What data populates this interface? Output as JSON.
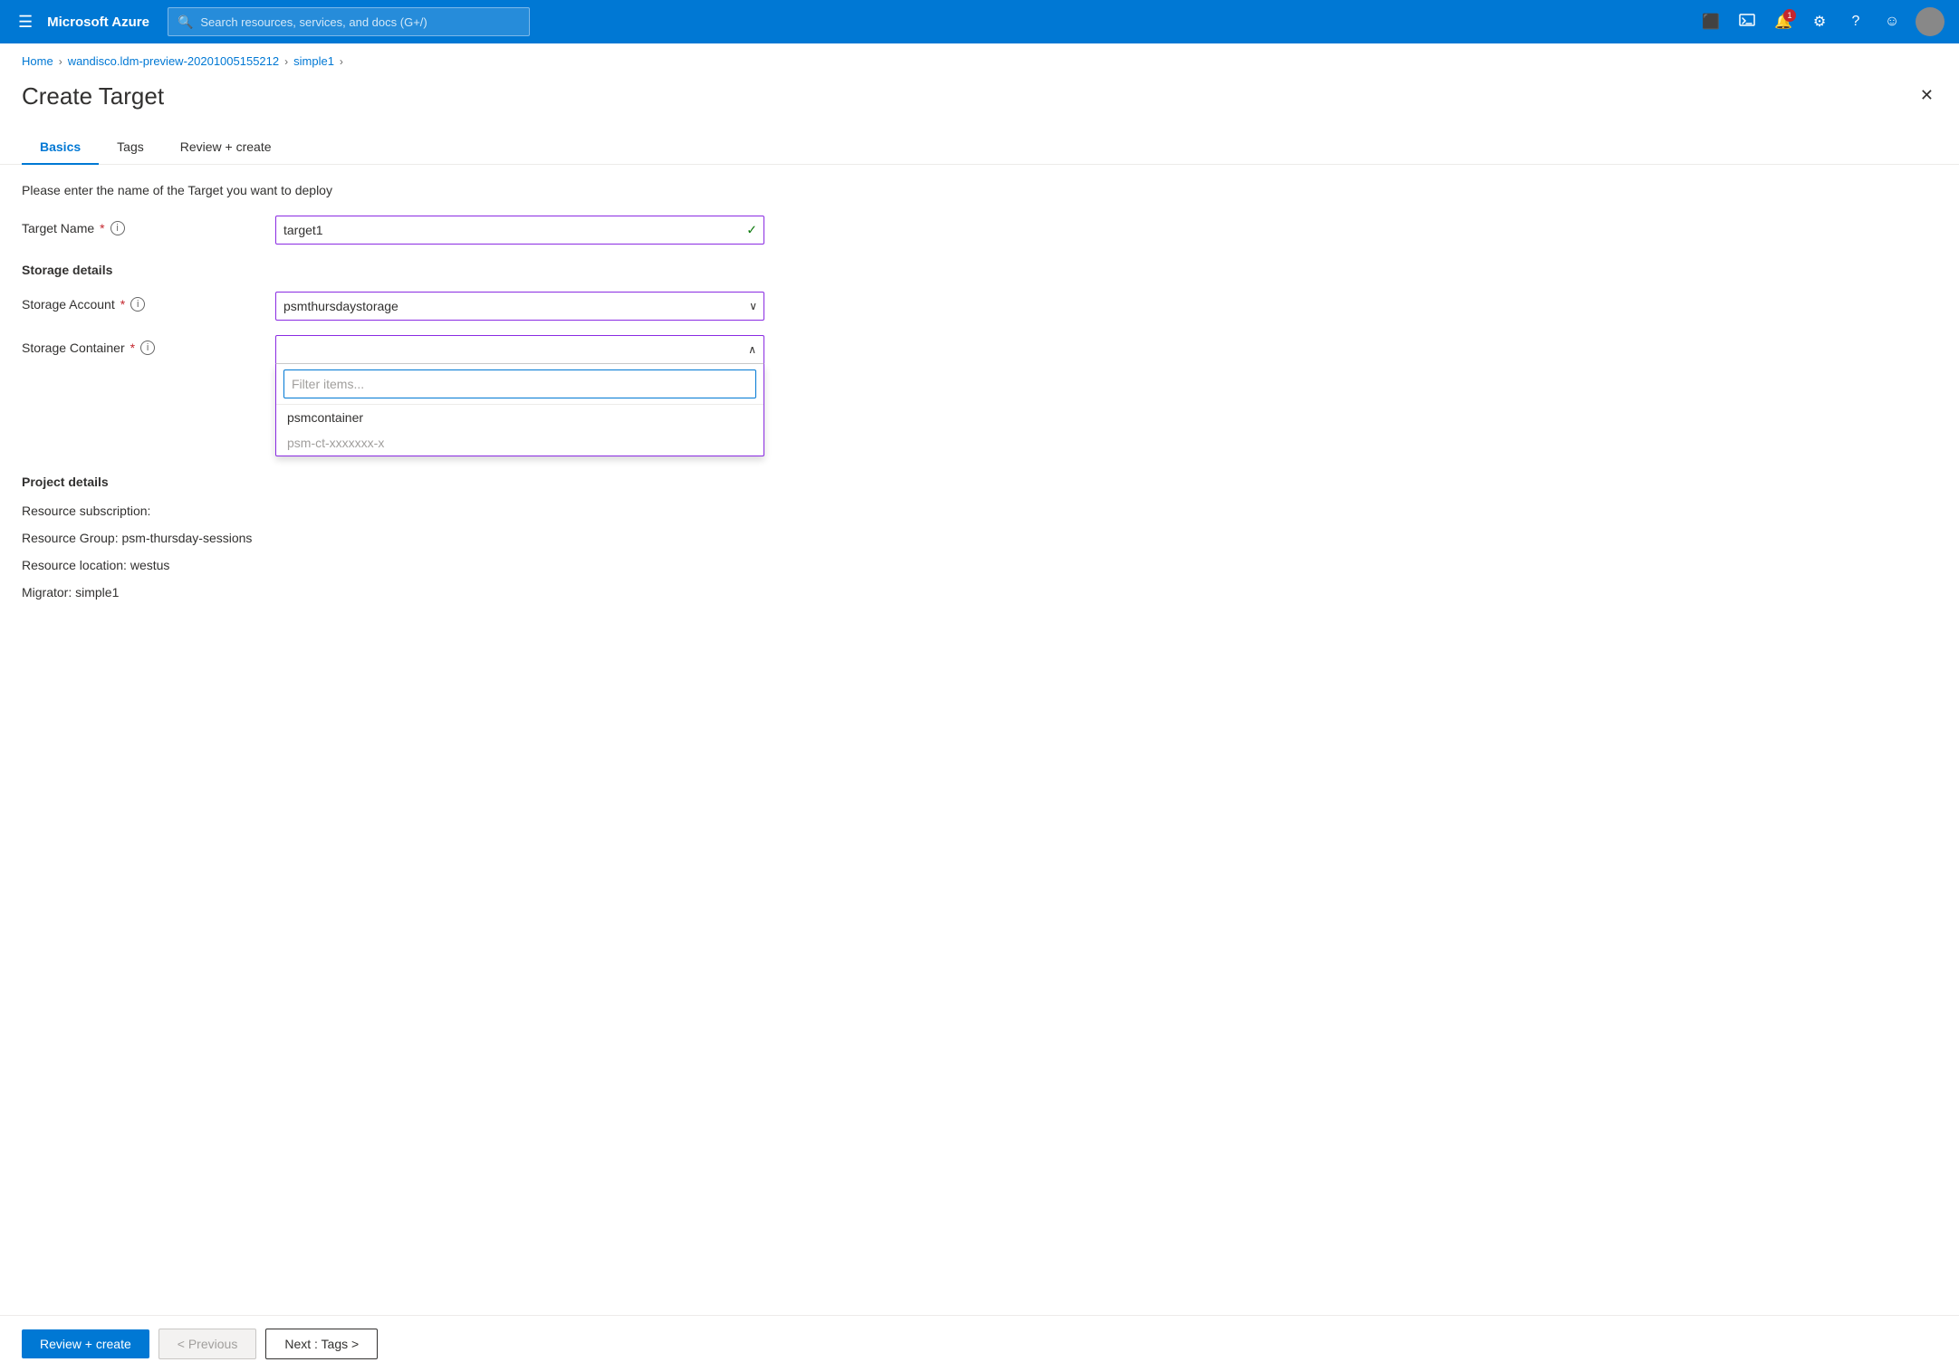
{
  "nav": {
    "hamburger_icon": "☰",
    "brand": "Microsoft Azure",
    "search_placeholder": "Search resources, services, and docs (G+/)",
    "terminal_icon": "⬛",
    "cloud_shell_icon": "🔧",
    "notifications_count": "1",
    "settings_icon": "⚙",
    "help_icon": "?",
    "feedback_icon": "☺"
  },
  "breadcrumb": {
    "items": [
      {
        "label": "Home",
        "href": "#"
      },
      {
        "label": "wandisco.ldm-preview-20201005155212",
        "href": "#"
      },
      {
        "label": "simple1",
        "href": "#"
      }
    ]
  },
  "page": {
    "title": "Create Target",
    "close_icon": "✕"
  },
  "tabs": [
    {
      "label": "Basics",
      "active": true
    },
    {
      "label": "Tags",
      "active": false
    },
    {
      "label": "Review + create",
      "active": false
    }
  ],
  "form": {
    "description": "Please enter the name of the Target you want to deploy",
    "target_name_label": "Target Name",
    "target_name_value": "target1",
    "storage_details_heading": "Storage details",
    "storage_account_label": "Storage Account",
    "storage_account_value": "psmthursdaystorage",
    "storage_container_label": "Storage Container",
    "storage_container_value": "",
    "filter_placeholder": "Filter items...",
    "dropdown_item_1": "psmcontainer",
    "dropdown_item_2": "psm-ct-xxxxxxx-x",
    "project_details_heading": "Project details",
    "resource_subscription_label": "Resource subscription:",
    "resource_subscription_value": "",
    "resource_group_label": "Resource Group: psm-thursday-sessions",
    "resource_location_label": "Resource location: westus",
    "migrator_label": "Migrator: simple1"
  },
  "footer": {
    "review_create_label": "Review + create",
    "previous_label": "< Previous",
    "next_label": "Next : Tags >"
  }
}
